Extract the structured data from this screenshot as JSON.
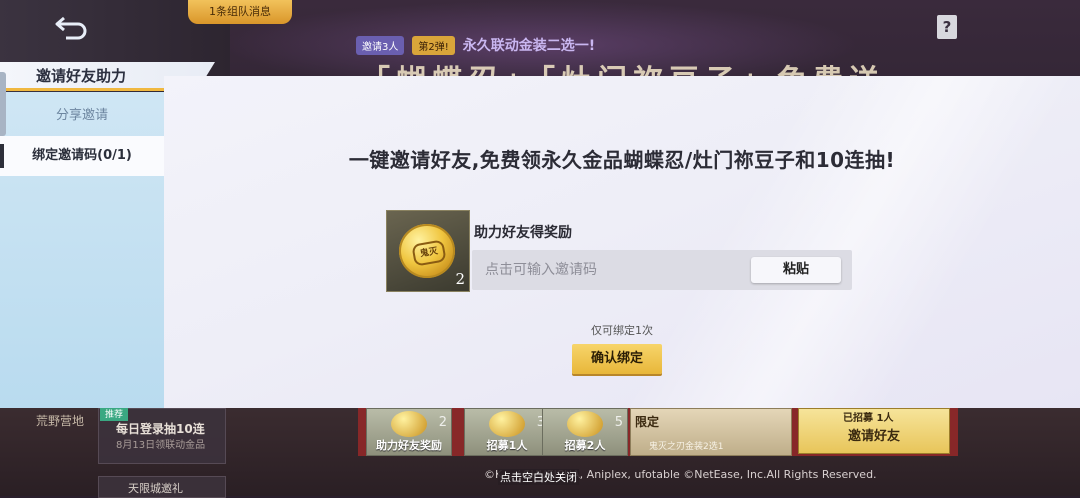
{
  "background": {
    "notice_tab": "1条组队消息",
    "banner_chip1": "邀请3人",
    "banner_chip2": "第2弹!",
    "banner_text": "永久联动金装二选一!",
    "banner_title": "「蝴蝶忍」「灶门祢豆子」免费送",
    "help_icon_glyph": "?",
    "wild_label": "荒野营地",
    "daily_badge": "推荐",
    "daily_title": "每日登录抽10连",
    "daily_sub": "8月13日领联动金品",
    "daily_title2": "天限城邀礼",
    "tiers": [
      {
        "label": "助力好友奖励",
        "num": "2"
      },
      {
        "label": "招募1人",
        "num": "3"
      },
      {
        "label": "招募2人",
        "num": "5"
      }
    ],
    "limited_tag": "限定",
    "limited_sub": "鬼灭之刃金装2选1",
    "invite_top": "已招募 1人",
    "invite_text": "邀请好友",
    "copyright": "©K... / SHUEISHA, Aniplex, ufotable  ©NetEase, Inc.All Rights Reserved.",
    "close_hint": "点击空白处关闭"
  },
  "sidebar": {
    "header": "邀请好友助力",
    "items": [
      {
        "label": "分享邀请",
        "active": false
      },
      {
        "label": "绑定邀请码(0/1)",
        "active": true
      }
    ]
  },
  "panel": {
    "headline": "一键邀请好友,免费领永久金品蝴蝶忍/灶门祢豆子和10连抽!",
    "reward": {
      "label": "助力好友得奖励",
      "count": "2",
      "coin_mark": "鬼灭"
    },
    "input_placeholder": "点击可输入邀请码",
    "input_value": "",
    "paste_label": "粘贴",
    "limit_note": "仅可绑定1次",
    "confirm_label": "确认绑定"
  },
  "colors": {
    "accent_gold": "#f0c640",
    "sidebar_blue": "#cfe6f4",
    "panel_bg": "#f1f1f8"
  }
}
